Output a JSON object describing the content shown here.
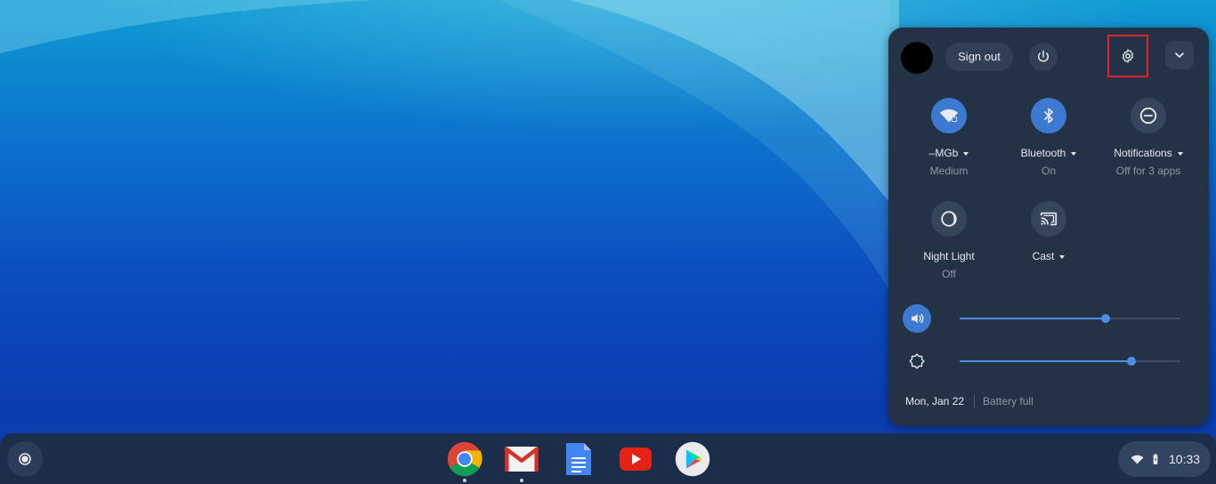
{
  "tray": {
    "sign_out_label": "Sign out",
    "features": [
      {
        "label": "–MGb",
        "sub": "Medium",
        "state": "on",
        "icon": "wifi-icon"
      },
      {
        "label": "Bluetooth",
        "sub": "On",
        "state": "on",
        "icon": "bluetooth-icon"
      },
      {
        "label": "Notifications",
        "sub": "Off for 3 apps",
        "state": "off",
        "icon": "do-not-disturb-icon"
      },
      {
        "label": "Night Light",
        "sub": "Off",
        "state": "off",
        "icon": "night-light-icon"
      },
      {
        "label": "Cast",
        "sub": "",
        "state": "off",
        "icon": "cast-icon"
      }
    ],
    "volume_level": 0.66,
    "brightness_level": 0.78,
    "date": "Mon, Jan 22",
    "battery_status": "Battery full"
  },
  "shelf": {
    "apps": [
      "chrome-icon",
      "gmail-icon",
      "docs-icon",
      "youtube-icon",
      "play-store-icon"
    ],
    "time": "10:33"
  },
  "colors": {
    "accent": "#3c7ad2",
    "panel": "#243245",
    "shelf": "#1c2d4a",
    "highlight": "#e0212b"
  }
}
